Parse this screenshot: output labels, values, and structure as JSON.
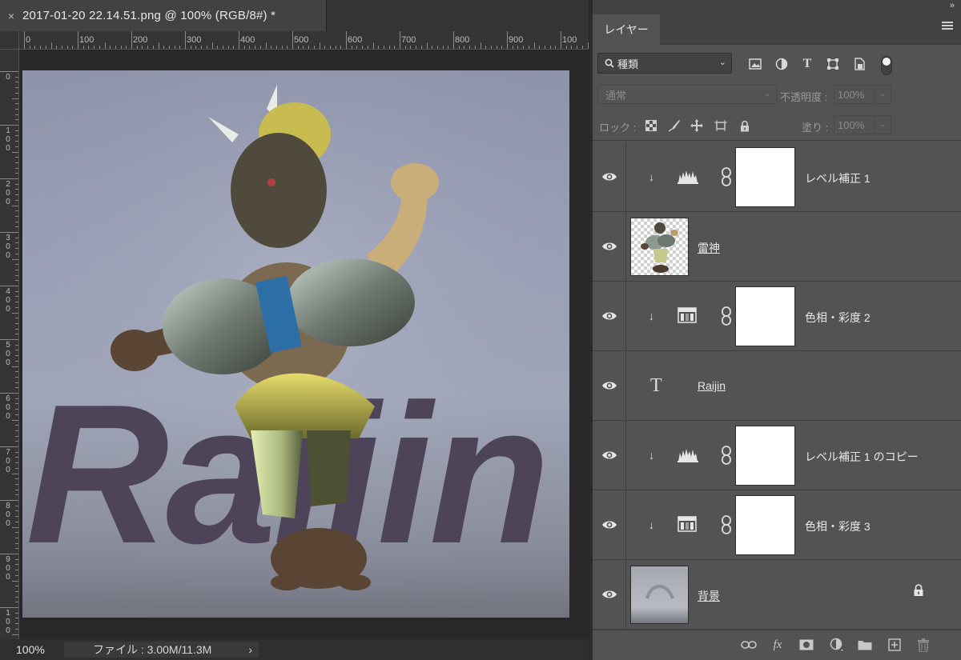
{
  "document": {
    "tab_close": "×",
    "tab_title": "2017-01-20 22.14.51.png @ 100% (RGB/8#) *",
    "ruler_h": [
      "0",
      "100",
      "200",
      "300",
      "400",
      "500",
      "600",
      "700",
      "800",
      "900",
      "100"
    ],
    "ruler_v": [
      "0",
      "1\n0\n0",
      "2\n0\n0",
      "3\n0\n0",
      "4\n0\n0",
      "5\n0\n0",
      "6\n0\n0",
      "7\n0\n0",
      "8\n0\n0",
      "9\n0\n0",
      "1\n0\n0"
    ],
    "canvas_text": "Raijin",
    "zoom": "100%",
    "file_info": "ファイル : 3.00M/11.3M",
    "file_info_arrow": "›"
  },
  "panel": {
    "collapse": "»",
    "tab_layers": "レイヤー",
    "filter_kind": "種類",
    "blend_mode": "通常",
    "opacity_label": "不透明度 :",
    "opacity_value": "100%",
    "lock_label": "ロック :",
    "fill_label": "塗り :",
    "fill_value": "100%",
    "layers": [
      {
        "name": "レベル補正 1",
        "type": "levels",
        "clipped": true
      },
      {
        "name": "雷神",
        "type": "pixel",
        "clipped": false
      },
      {
        "name": "色相・彩度 2",
        "type": "hue-saturation",
        "clipped": true
      },
      {
        "name": "Raijin",
        "type": "text",
        "clipped": false
      },
      {
        "name": "レベル補正 1 のコピー",
        "type": "levels",
        "clipped": true
      },
      {
        "name": "色相・彩度 3",
        "type": "hue-saturation",
        "clipped": true
      },
      {
        "name": "背景",
        "type": "background",
        "clipped": false,
        "locked": true
      }
    ],
    "footer_icons": [
      "link-icon",
      "fx-icon",
      "mask-icon",
      "adjustment-icon",
      "folder-icon",
      "new-layer-icon",
      "trash-icon"
    ],
    "fx_label": "fx"
  },
  "colors": {
    "panel_bg": "#535353",
    "doc_bg": "#282828",
    "text_color": "#4e4459"
  }
}
